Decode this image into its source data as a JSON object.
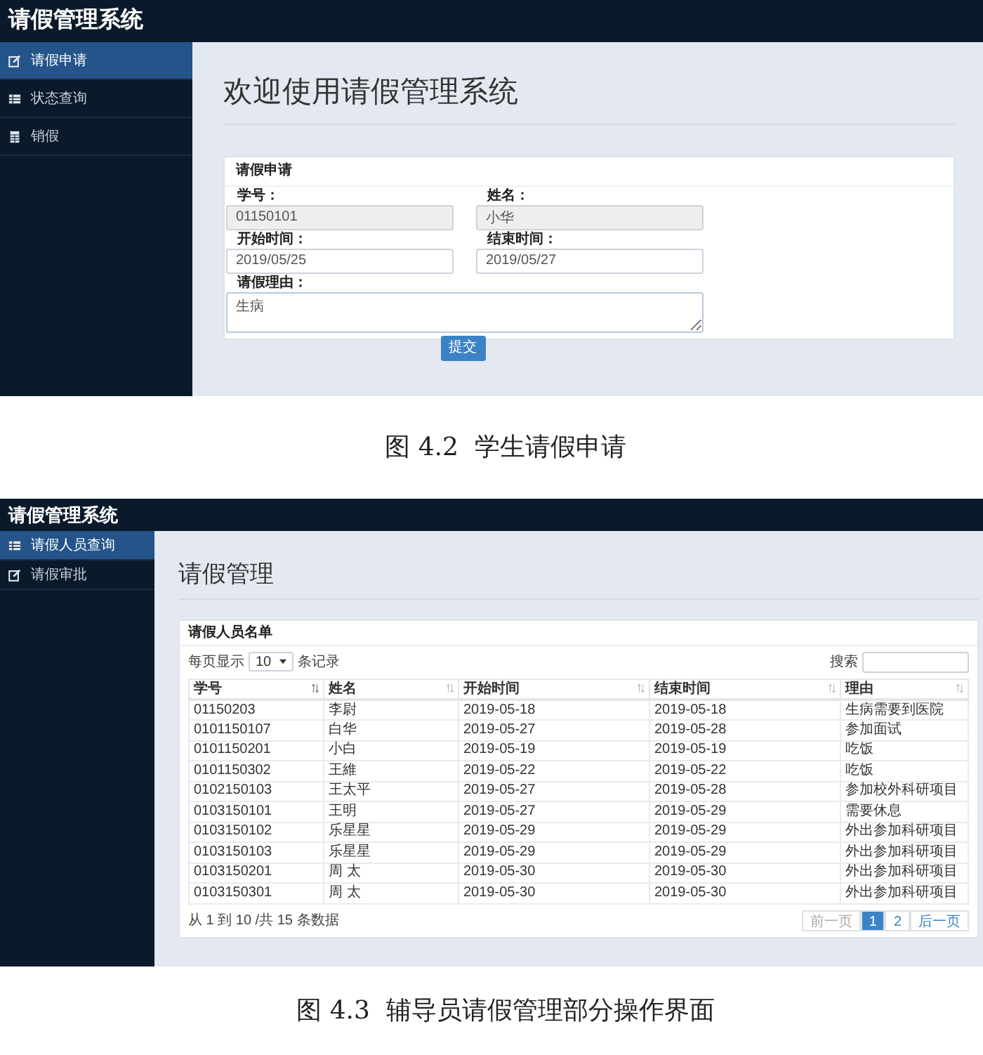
{
  "figure_1": {
    "app_title": "请假管理系统",
    "sidebar": {
      "items": [
        {
          "label": "请假申请",
          "selected": true
        },
        {
          "label": "状态查询",
          "selected": false
        },
        {
          "label": "销假",
          "selected": false
        }
      ]
    },
    "page_title": "欢迎使用请假管理系统",
    "panel": {
      "title": "请假申请",
      "fields": [
        {
          "label": "学号：",
          "value": "01150101",
          "disabled": true
        },
        {
          "label": "姓名：",
          "value": "小华",
          "disabled": true
        },
        {
          "label": "开始时间：",
          "value": "2019/05/25",
          "disabled": false
        },
        {
          "label": "结束时间：",
          "value": "2019/05/27",
          "disabled": false
        }
      ],
      "reason": {
        "label": "请假理由：",
        "value": "生病"
      }
    },
    "submit_button": "提交",
    "caption": "图 4.2  学生请假申请"
  },
  "figure_2": {
    "app_title": "请假管理系统",
    "sidebar": {
      "items": [
        {
          "label": "请假人员查询",
          "selected": true
        },
        {
          "label": "请假审批",
          "selected": false
        }
      ]
    },
    "page_title": "请假管理",
    "panel": {
      "title": "请假人员名单",
      "length_prefix": "每页显示",
      "length_value": "10",
      "length_suffix": "条记录",
      "search_label": "搜索",
      "table": {
        "columns": [
          "学号",
          "姓名",
          "开始时间",
          "结束时间",
          "理由"
        ],
        "rows": [
          [
            "01150203",
            "李尉",
            "2019-05-18",
            "2019-05-18",
            "生病需要到医院"
          ],
          [
            "0101150107",
            "白华",
            "2019-05-27",
            "2019-05-28",
            "参加面试"
          ],
          [
            "0101150201",
            "小白",
            "2019-05-19",
            "2019-05-19",
            "吃饭"
          ],
          [
            "0101150302",
            "王維",
            "2019-05-22",
            "2019-05-22",
            "吃饭"
          ],
          [
            "0102150103",
            "王太平",
            "2019-05-27",
            "2019-05-28",
            "参加校外科研项目"
          ],
          [
            "0103150101",
            "王明",
            "2019-05-27",
            "2019-05-29",
            "需要休息"
          ],
          [
            "0103150102",
            "乐星星",
            "2019-05-29",
            "2019-05-29",
            "外出参加科研项目"
          ],
          [
            "0103150103",
            "乐星星",
            "2019-05-29",
            "2019-05-29",
            "外出参加科研项目"
          ],
          [
            "0103150201",
            "周 太",
            "2019-05-30",
            "2019-05-30",
            "外出参加科研项目"
          ],
          [
            "0103150301",
            "周 太",
            "2019-05-30",
            "2019-05-30",
            "外出参加科研项目"
          ]
        ]
      },
      "info": "从 1 到 10 /共 15 条数据",
      "pagination": [
        {
          "label": "前一页",
          "selected": false,
          "disabled": true
        },
        {
          "label": "1",
          "selected": true,
          "disabled": false
        },
        {
          "label": "2",
          "selected": false,
          "disabled": false
        },
        {
          "label": "后一页",
          "selected": false,
          "disabled": false
        }
      ]
    },
    "caption": "图 4.3  辅导员请假管理部分操作界面"
  }
}
